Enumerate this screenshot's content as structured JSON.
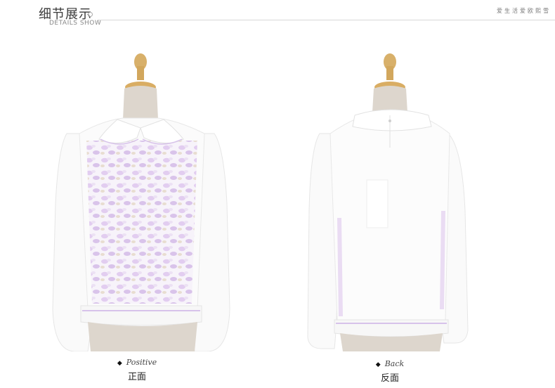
{
  "header": {
    "title_cn": "细节展示",
    "title_en": "DETAILS SHOW",
    "slogan": "爱生活爱欧熙雪"
  },
  "front": {
    "label_en": "Positive",
    "label_cn": "正面",
    "diamond": "◆"
  },
  "back": {
    "label_en": "Back",
    "label_cn": "反面",
    "diamond": "◆"
  },
  "colors": {
    "accent_lilac": "#d7c2ea",
    "fabric": "#fbfbfb",
    "dress_form": "#d9d0c6",
    "neck_wood": "#d8b06a"
  }
}
